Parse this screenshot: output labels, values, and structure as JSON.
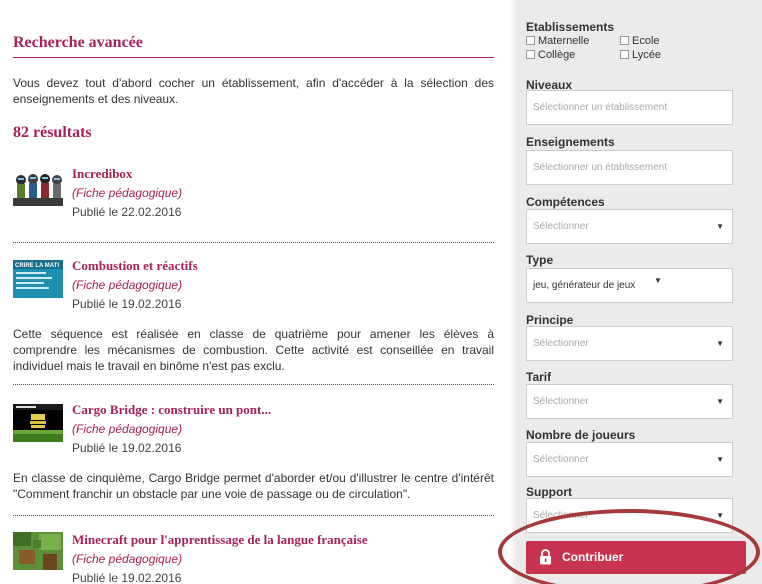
{
  "search": {
    "title": "Recherche avancée",
    "intro": "Vous devez tout d'abord cocher un établissement, afin d'accéder à la sélection des enseignements et des niveaux.",
    "results_count": "82 résultats"
  },
  "results": [
    {
      "title": "Incredibox",
      "type": "(Fiche pédagogique)",
      "date": "Publié le 22.02.2016",
      "description": ""
    },
    {
      "title": "Combustion et réactifs",
      "type": "(Fiche pédagogique)",
      "date": "Publié le 19.02.2016",
      "description": "Cette séquence est réalisée en classe de quatrième pour amener les élèves à comprendre les mécanismes de combustion. Cette activité est conseillée en travail individuel mais le travail en binôme n'est pas exclu.",
      "thumb_text": "CRIRE LA MATI"
    },
    {
      "title": "Cargo Bridge : construire un pont...",
      "type": "(Fiche pédagogique)",
      "date": "Publié le 19.02.2016",
      "description": "En classe de cinquième, Cargo Bridge permet d'aborder et/ou d'illustrer le centre d'intérêt \"Comment franchir un obstacle par une voie de passage ou de circulation\"."
    },
    {
      "title": "Minecraft pour l'apprentissage de la langue française",
      "type": "(Fiche pédagogique)",
      "date": "Publié le 19.02.2016",
      "description": ""
    }
  ],
  "filters": {
    "etablissements": {
      "label": "Etablissements",
      "options": [
        "Maternelle",
        "Ecole",
        "Collège",
        "Lycée"
      ]
    },
    "niveaux": {
      "label": "Niveaux",
      "placeholder": "Sélectionner un établissement"
    },
    "enseignements": {
      "label": "Enseignements",
      "placeholder": "Sélectionner un établissement"
    },
    "competences": {
      "label": "Compétences",
      "placeholder": "Sélectionner"
    },
    "type": {
      "label": "Type",
      "value": "jeu,  générateur de jeux"
    },
    "principe": {
      "label": "Principe",
      "placeholder": "Sélectionner"
    },
    "tarif": {
      "label": "Tarif",
      "placeholder": "Sélectionner"
    },
    "joueurs": {
      "label": "Nombre de joueurs",
      "placeholder": "Sélectionner"
    },
    "support": {
      "label": "Support",
      "placeholder": "Sélectionner"
    }
  },
  "contribute": {
    "label": "Contribuer",
    "icon": "lock-icon"
  },
  "colors": {
    "accent": "#a82255",
    "button": "#c8334f",
    "sidebar_bg": "#ebebeb",
    "highlight": "#a43a3a"
  }
}
